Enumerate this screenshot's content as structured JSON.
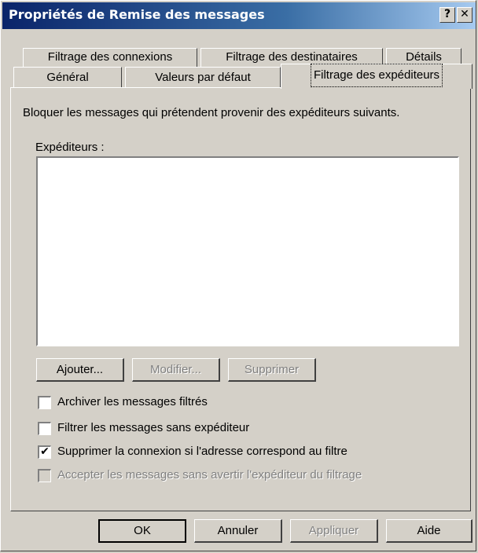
{
  "window": {
    "title": "Propriétés de Remise des messages",
    "help_button": "?",
    "close_button": "✕"
  },
  "tabs": {
    "row1": [
      "Filtrage des connexions",
      "Filtrage des destinataires",
      "Détails"
    ],
    "row2": [
      "Général",
      "Valeurs par défaut",
      "Filtrage des expéditeurs"
    ],
    "active": "Filtrage des expéditeurs"
  },
  "content": {
    "description": "Bloquer les messages qui prétendent provenir des expéditeurs suivants.",
    "senders_label": "Expéditeurs :",
    "senders_list": []
  },
  "list_buttons": {
    "add": "Ajouter...",
    "modify": "Modifier...",
    "delete": "Supprimer"
  },
  "options": [
    {
      "label": "Archiver les messages filtrés",
      "checked": false,
      "enabled": true
    },
    {
      "label": "Filtrer les messages sans expéditeur",
      "checked": false,
      "enabled": true
    },
    {
      "label": "Supprimer la connexion si l'adresse correspond au filtre",
      "checked": true,
      "enabled": true
    },
    {
      "label": "Accepter les messages sans avertir l'expéditeur du filtrage",
      "checked": false,
      "enabled": false
    }
  ],
  "footer": {
    "ok": "OK",
    "cancel": "Annuler",
    "apply": "Appliquer",
    "help": "Aide"
  },
  "colors": {
    "title_bar_start": "#0a246a",
    "title_bar_end": "#a6caf0",
    "face": "#d4d0c8",
    "disabled_text": "#808080"
  }
}
